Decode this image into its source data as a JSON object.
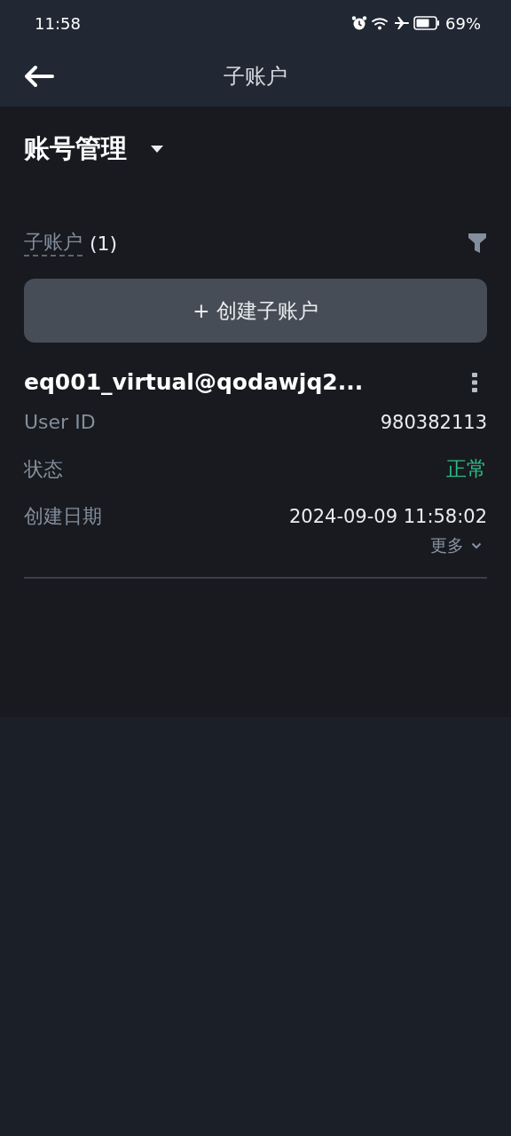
{
  "status_bar": {
    "time": "11:58",
    "battery": "69%"
  },
  "nav": {
    "title": "子账户"
  },
  "section": {
    "title": "账号管理"
  },
  "subaccounts": {
    "label": "子账户",
    "count": "(1)",
    "create_button": "+ 创建子账户"
  },
  "accounts": [
    {
      "name": "eq001_virtual@qodawjq2...",
      "fields": [
        {
          "label": "User ID",
          "value": "980382113",
          "kind": "text"
        },
        {
          "label": "状态",
          "value": "正常",
          "kind": "status"
        },
        {
          "label": "创建日期",
          "value": "2024-09-09 11:58:02",
          "kind": "text"
        }
      ],
      "more": "更多"
    }
  ]
}
